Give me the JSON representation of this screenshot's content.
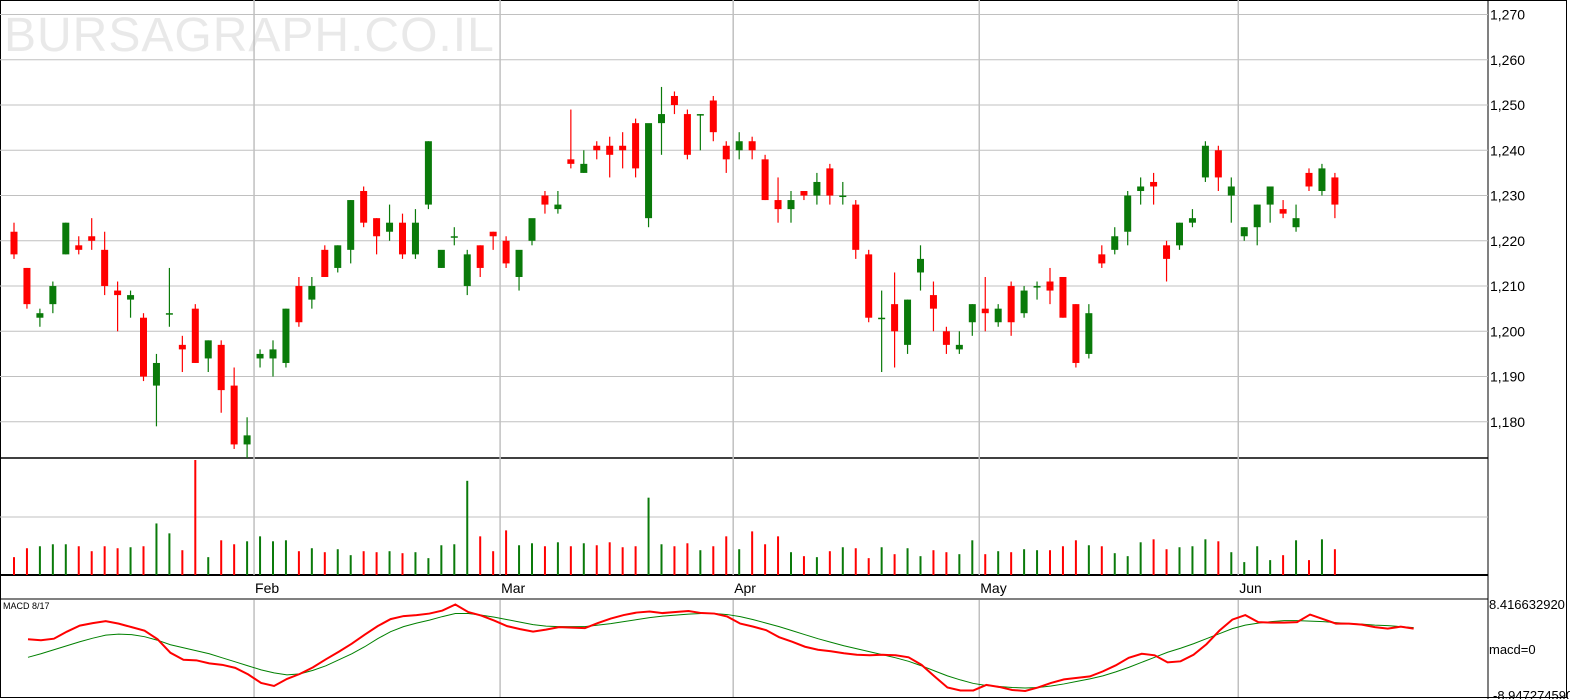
{
  "watermark": "BURSAGRAPH.CO.IL",
  "colors": {
    "up": "#0a7a0a",
    "down": "#ff0000",
    "grid": "#c0c0c0",
    "macd_line": "#ff0000",
    "signal_line": "#008000"
  },
  "chart_data": [
    {
      "type": "candlestick",
      "panel": "price",
      "title": "",
      "ylim": [
        1172,
        1271
      ],
      "y_ticks": [
        "1,180",
        "1,190",
        "1,200",
        "1,210",
        "1,220",
        "1,230",
        "1,240",
        "1,250",
        "1,260",
        "1,270"
      ],
      "y_tick_values": [
        1180,
        1190,
        1200,
        1210,
        1220,
        1230,
        1240,
        1250,
        1260,
        1270
      ],
      "x_labels": [
        {
          "label": "Feb",
          "index": 19
        },
        {
          "label": "Mar",
          "index": 38
        },
        {
          "label": "Apr",
          "index": 56
        },
        {
          "label": "May",
          "index": 75
        },
        {
          "label": "Jun",
          "index": 95
        }
      ],
      "grid": true,
      "candles": [
        {
          "o": 1222,
          "h": 1224,
          "l": 1216,
          "c": 1217
        },
        {
          "o": 1214,
          "h": 1214,
          "l": 1205,
          "c": 1206
        },
        {
          "o": 1203,
          "h": 1205,
          "l": 1201,
          "c": 1204
        },
        {
          "o": 1206,
          "h": 1211,
          "l": 1204,
          "c": 1210
        },
        {
          "o": 1217,
          "h": 1224,
          "l": 1217,
          "c": 1224
        },
        {
          "o": 1219,
          "h": 1221,
          "l": 1217,
          "c": 1218
        },
        {
          "o": 1221,
          "h": 1225,
          "l": 1218,
          "c": 1220
        },
        {
          "o": 1218,
          "h": 1222,
          "l": 1208,
          "c": 1210
        },
        {
          "o": 1209,
          "h": 1211,
          "l": 1200,
          "c": 1208
        },
        {
          "o": 1207,
          "h": 1209,
          "l": 1203,
          "c": 1208
        },
        {
          "o": 1203,
          "h": 1204,
          "l": 1189,
          "c": 1190
        },
        {
          "o": 1188,
          "h": 1195,
          "l": 1179,
          "c": 1193
        },
        {
          "o": 1204,
          "h": 1214,
          "l": 1201,
          "c": 1204
        },
        {
          "o": 1197,
          "h": 1199,
          "l": 1191,
          "c": 1196
        },
        {
          "o": 1205,
          "h": 1206,
          "l": 1193,
          "c": 1193
        },
        {
          "o": 1194,
          "h": 1198,
          "l": 1191,
          "c": 1198
        },
        {
          "o": 1197,
          "h": 1198,
          "l": 1182,
          "c": 1187
        },
        {
          "o": 1188,
          "h": 1192,
          "l": 1174,
          "c": 1175
        },
        {
          "o": 1175,
          "h": 1181,
          "l": 1172,
          "c": 1177
        },
        {
          "o": 1194,
          "h": 1196,
          "l": 1192,
          "c": 1195
        },
        {
          "o": 1194,
          "h": 1198,
          "l": 1190,
          "c": 1196
        },
        {
          "o": 1193,
          "h": 1205,
          "l": 1192,
          "c": 1205
        },
        {
          "o": 1210,
          "h": 1212,
          "l": 1201,
          "c": 1202
        },
        {
          "o": 1207,
          "h": 1212,
          "l": 1205,
          "c": 1210
        },
        {
          "o": 1218,
          "h": 1219,
          "l": 1212,
          "c": 1212
        },
        {
          "o": 1214,
          "h": 1219,
          "l": 1213,
          "c": 1219
        },
        {
          "o": 1218,
          "h": 1229,
          "l": 1215,
          "c": 1229
        },
        {
          "o": 1231,
          "h": 1232,
          "l": 1223,
          "c": 1224
        },
        {
          "o": 1225,
          "h": 1225,
          "l": 1217,
          "c": 1221
        },
        {
          "o": 1222,
          "h": 1228,
          "l": 1220,
          "c": 1224
        },
        {
          "o": 1224,
          "h": 1226,
          "l": 1216,
          "c": 1217
        },
        {
          "o": 1217,
          "h": 1227,
          "l": 1216,
          "c": 1224
        },
        {
          "o": 1228,
          "h": 1242,
          "l": 1227,
          "c": 1242
        },
        {
          "o": 1214,
          "h": 1217,
          "l": 1214,
          "c": 1218
        },
        {
          "o": 1221,
          "h": 1223,
          "l": 1219,
          "c": 1221
        },
        {
          "o": 1210,
          "h": 1218,
          "l": 1208,
          "c": 1217
        },
        {
          "o": 1219,
          "h": 1219,
          "l": 1212,
          "c": 1214
        },
        {
          "o": 1222,
          "h": 1222,
          "l": 1218,
          "c": 1221
        },
        {
          "o": 1220,
          "h": 1221,
          "l": 1214,
          "c": 1215
        },
        {
          "o": 1212,
          "h": 1213,
          "l": 1209,
          "c": 1218
        },
        {
          "o": 1220,
          "h": 1223,
          "l": 1219,
          "c": 1225
        },
        {
          "o": 1230,
          "h": 1231,
          "l": 1226,
          "c": 1228
        },
        {
          "o": 1227,
          "h": 1231,
          "l": 1226,
          "c": 1228
        },
        {
          "o": 1238,
          "h": 1249,
          "l": 1236,
          "c": 1237
        },
        {
          "o": 1235,
          "h": 1240,
          "l": 1235,
          "c": 1237
        },
        {
          "o": 1241,
          "h": 1242,
          "l": 1238,
          "c": 1240
        },
        {
          "o": 1241,
          "h": 1243,
          "l": 1234,
          "c": 1239
        },
        {
          "o": 1241,
          "h": 1244,
          "l": 1236,
          "c": 1240
        },
        {
          "o": 1246,
          "h": 1247,
          "l": 1234,
          "c": 1236
        },
        {
          "o": 1225,
          "h": 1226,
          "l": 1223,
          "c": 1246
        },
        {
          "o": 1246,
          "h": 1254,
          "l": 1239,
          "c": 1248
        },
        {
          "o": 1252,
          "h": 1253,
          "l": 1248,
          "c": 1250
        },
        {
          "o": 1248,
          "h": 1249,
          "l": 1238,
          "c": 1239
        },
        {
          "o": 1248,
          "h": 1248,
          "l": 1240,
          "c": 1248
        },
        {
          "o": 1251,
          "h": 1252,
          "l": 1242,
          "c": 1244
        },
        {
          "o": 1241,
          "h": 1242,
          "l": 1235,
          "c": 1238
        },
        {
          "o": 1240,
          "h": 1244,
          "l": 1238,
          "c": 1242
        },
        {
          "o": 1242,
          "h": 1243,
          "l": 1238,
          "c": 1240
        },
        {
          "o": 1238,
          "h": 1239,
          "l": 1229,
          "c": 1229
        },
        {
          "o": 1229,
          "h": 1234,
          "l": 1224,
          "c": 1227
        },
        {
          "o": 1227,
          "h": 1231,
          "l": 1224,
          "c": 1229
        },
        {
          "o": 1231,
          "h": 1231,
          "l": 1229,
          "c": 1230
        },
        {
          "o": 1230,
          "h": 1235,
          "l": 1228,
          "c": 1233
        },
        {
          "o": 1236,
          "h": 1237,
          "l": 1228,
          "c": 1230
        },
        {
          "o": 1230,
          "h": 1233,
          "l": 1228,
          "c": 1230
        },
        {
          "o": 1228,
          "h": 1229,
          "l": 1216,
          "c": 1218
        },
        {
          "o": 1217,
          "h": 1218,
          "l": 1202,
          "c": 1203
        },
        {
          "o": 1203,
          "h": 1209,
          "l": 1191,
          "c": 1203
        },
        {
          "o": 1206,
          "h": 1213,
          "l": 1192,
          "c": 1200
        },
        {
          "o": 1197,
          "h": 1207,
          "l": 1195,
          "c": 1207
        },
        {
          "o": 1213,
          "h": 1219,
          "l": 1209,
          "c": 1216
        },
        {
          "o": 1208,
          "h": 1211,
          "l": 1200,
          "c": 1205
        },
        {
          "o": 1200,
          "h": 1201,
          "l": 1195,
          "c": 1197
        },
        {
          "o": 1196,
          "h": 1200,
          "l": 1195,
          "c": 1197
        },
        {
          "o": 1202,
          "h": 1206,
          "l": 1199,
          "c": 1206
        },
        {
          "o": 1205,
          "h": 1212,
          "l": 1200,
          "c": 1204
        },
        {
          "o": 1202,
          "h": 1206,
          "l": 1201,
          "c": 1205
        },
        {
          "o": 1210,
          "h": 1211,
          "l": 1199,
          "c": 1202
        },
        {
          "o": 1204,
          "h": 1210,
          "l": 1203,
          "c": 1209
        },
        {
          "o": 1210,
          "h": 1211,
          "l": 1207,
          "c": 1210
        },
        {
          "o": 1211,
          "h": 1214,
          "l": 1206,
          "c": 1209
        },
        {
          "o": 1212,
          "h": 1212,
          "l": 1203,
          "c": 1203
        },
        {
          "o": 1206,
          "h": 1206,
          "l": 1192,
          "c": 1193
        },
        {
          "o": 1195,
          "h": 1206,
          "l": 1194,
          "c": 1204
        },
        {
          "o": 1217,
          "h": 1219,
          "l": 1214,
          "c": 1215
        },
        {
          "o": 1218,
          "h": 1223,
          "l": 1217,
          "c": 1221
        },
        {
          "o": 1222,
          "h": 1231,
          "l": 1219,
          "c": 1230
        },
        {
          "o": 1231,
          "h": 1234,
          "l": 1228,
          "c": 1232
        },
        {
          "o": 1233,
          "h": 1235,
          "l": 1228,
          "c": 1232
        },
        {
          "o": 1219,
          "h": 1220,
          "l": 1211,
          "c": 1216
        },
        {
          "o": 1219,
          "h": 1224,
          "l": 1218,
          "c": 1224
        },
        {
          "o": 1224,
          "h": 1227,
          "l": 1223,
          "c": 1225
        },
        {
          "o": 1234,
          "h": 1242,
          "l": 1233,
          "c": 1241
        },
        {
          "o": 1240,
          "h": 1241,
          "l": 1231,
          "c": 1234
        },
        {
          "o": 1230,
          "h": 1234,
          "l": 1224,
          "c": 1232
        },
        {
          "o": 1221,
          "h": 1223,
          "l": 1220,
          "c": 1223
        },
        {
          "o": 1223,
          "h": 1228,
          "l": 1219,
          "c": 1228
        },
        {
          "o": 1228,
          "h": 1230,
          "l": 1224,
          "c": 1232
        },
        {
          "o": 1227,
          "h": 1229,
          "l": 1225,
          "c": 1226
        },
        {
          "o": 1223,
          "h": 1228,
          "l": 1222,
          "c": 1225
        },
        {
          "o": 1235,
          "h": 1236,
          "l": 1231,
          "c": 1232
        },
        {
          "o": 1231,
          "h": 1237,
          "l": 1230,
          "c": 1236
        },
        {
          "o": 1234,
          "h": 1235,
          "l": 1225,
          "c": 1228
        }
      ]
    },
    {
      "type": "bar",
      "panel": "volume",
      "values": [
        18,
        27,
        29,
        31,
        31,
        29,
        24,
        29,
        27,
        28,
        29,
        52,
        42,
        25,
        116,
        18,
        35,
        31,
        34,
        39,
        34,
        35,
        24,
        27,
        23,
        26,
        20,
        24,
        23,
        24,
        22,
        23,
        17,
        30,
        31,
        95,
        39,
        24,
        45,
        30,
        32,
        29,
        33,
        29,
        32,
        30,
        33,
        28,
        29,
        78,
        31,
        29,
        32,
        25,
        29,
        39,
        26,
        44,
        31,
        39,
        23,
        19,
        18,
        24,
        28,
        27,
        17,
        28,
        21,
        27,
        19,
        25,
        23,
        21,
        35,
        21,
        24,
        23,
        26,
        25,
        25,
        29,
        35,
        30,
        29,
        22,
        19,
        33,
        36,
        26,
        28,
        29,
        36,
        34,
        23,
        13,
        29,
        15,
        20,
        35,
        15,
        36,
        26,
        28,
        29,
        36,
        36
      ]
    },
    {
      "type": "line",
      "panel": "macd",
      "label": "MACD 8/17",
      "right_labels": [
        "8.416632920",
        "macd=0",
        "-8.947274590"
      ],
      "series": [
        {
          "values": [
            2.1,
            1.9,
            2.2,
            3.6,
            4.8,
            5.3,
            5.7,
            5.2,
            4.5,
            3.8,
            2.1,
            -0.6,
            -2.0,
            -2.1,
            -2.7,
            -3.0,
            -3.6,
            -4.9,
            -6.6,
            -7.2,
            -5.8,
            -4.8,
            -3.5,
            -1.9,
            -0.4,
            1.2,
            3.0,
            4.7,
            6.1,
            6.7,
            6.9,
            7.2,
            7.8,
            9.0,
            7.5,
            6.8,
            5.8,
            4.7,
            4.1,
            3.6,
            4.0,
            4.5,
            4.4,
            4.3,
            5.3,
            6.2,
            6.9,
            7.4,
            7.6,
            7.3,
            7.5,
            7.7,
            7.3,
            7.2,
            6.6,
            5.2,
            4.6,
            3.9,
            2.5,
            1.6,
            0.6,
            0.0,
            -0.3,
            -0.7,
            -1.0,
            -1.1,
            -1.0,
            -1.1,
            -1.5,
            -3.0,
            -5.3,
            -7.5,
            -8.1,
            -8.1,
            -7.0,
            -7.4,
            -8.0,
            -8.2,
            -7.5,
            -6.6,
            -5.9,
            -5.6,
            -5.3,
            -4.3,
            -3.1,
            -1.6,
            -0.8,
            -1.1,
            -2.5,
            -2.3,
            -1.0,
            1.1,
            3.8,
            6.0,
            6.9,
            5.5,
            5.4,
            5.4,
            5.5,
            7.0,
            6.1,
            5.2,
            5.2,
            5.0,
            4.5,
            4.2,
            4.6,
            4.2
          ]
        },
        {
          "values": [
            -1.5,
            -0.8,
            0.0,
            0.8,
            1.6,
            2.3,
            2.9,
            3.1,
            3.0,
            2.6,
            1.9,
            1.0,
            0.4,
            -0.2,
            -0.8,
            -1.6,
            -2.4,
            -3.2,
            -4.0,
            -4.6,
            -5.0,
            -4.8,
            -4.1,
            -3.2,
            -2.0,
            -0.8,
            0.6,
            2.2,
            3.6,
            4.6,
            5.3,
            5.9,
            6.6,
            7.2,
            7.2,
            6.9,
            6.5,
            6.0,
            5.5,
            5.0,
            4.7,
            4.6,
            4.6,
            4.6,
            4.9,
            5.2,
            5.6,
            6.0,
            6.4,
            6.7,
            6.9,
            7.1,
            7.2,
            7.2,
            7.0,
            6.6,
            6.0,
            5.3,
            4.6,
            3.8,
            3.0,
            2.2,
            1.5,
            0.8,
            0.2,
            -0.4,
            -1.0,
            -1.6,
            -2.3,
            -3.2,
            -4.2,
            -5.2,
            -6.0,
            -6.7,
            -7.1,
            -7.3,
            -7.5,
            -7.6,
            -7.5,
            -7.2,
            -6.8,
            -6.3,
            -5.8,
            -5.2,
            -4.4,
            -3.5,
            -2.5,
            -1.5,
            -0.5,
            0.3,
            1.2,
            2.2,
            3.2,
            4.2,
            4.9,
            5.3,
            5.6,
            5.8,
            5.8,
            5.7,
            5.6,
            5.4,
            5.2,
            5.1,
            4.9,
            4.8,
            4.6,
            4.4
          ]
        }
      ]
    }
  ]
}
